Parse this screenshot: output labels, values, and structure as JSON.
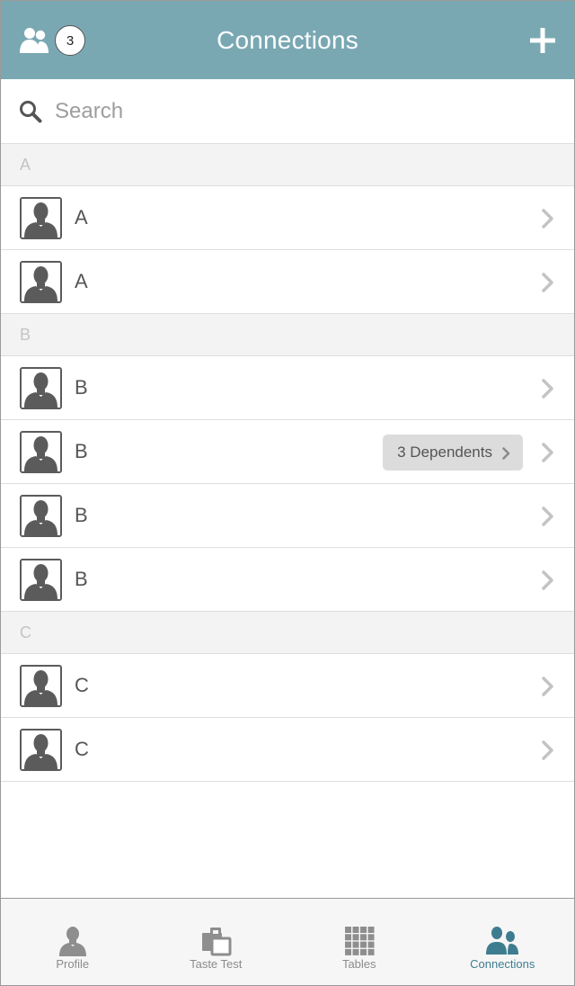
{
  "header": {
    "title": "Connections",
    "count": "3",
    "icon": "people-group-icon",
    "add_icon": "plus-icon",
    "color": "#79a8b3"
  },
  "search": {
    "placeholder": "Search",
    "value": ""
  },
  "sections": [
    {
      "letter": "A",
      "rows": [
        {
          "name": "A"
        },
        {
          "name": "A"
        }
      ]
    },
    {
      "letter": "B",
      "rows": [
        {
          "name": "B"
        },
        {
          "name": "B",
          "dependents": "3 Dependents"
        },
        {
          "name": "B"
        },
        {
          "name": "B"
        }
      ]
    },
    {
      "letter": "C",
      "rows": [
        {
          "name": "C"
        },
        {
          "name": "C"
        }
      ]
    }
  ],
  "tabs": [
    {
      "label": "Profile",
      "icon": "person-icon",
      "active": false
    },
    {
      "label": "Taste Test",
      "icon": "taste-test-icon",
      "active": false
    },
    {
      "label": "Tables",
      "icon": "grid-icon",
      "active": false
    },
    {
      "label": "Connections",
      "icon": "connections-icon",
      "active": true
    }
  ],
  "colors": {
    "accent": "#3e7d90",
    "section_bg": "#f3f3f3"
  }
}
